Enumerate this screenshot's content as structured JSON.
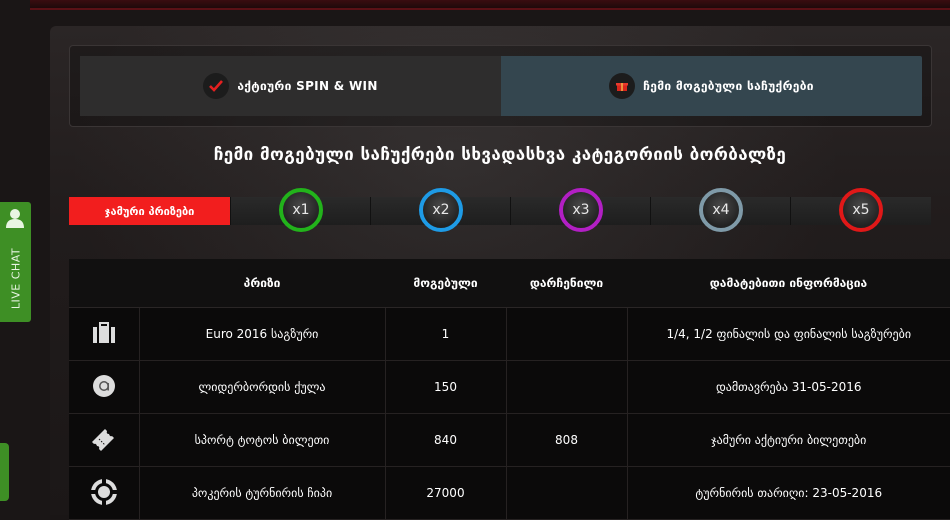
{
  "colors": {
    "accent_red": "#f21e1e",
    "live_chat_green": "#3e8f25",
    "x1": "#22b31b",
    "x2": "#1e9be6",
    "x3": "#b21fc4",
    "x4": "#7f9aa8",
    "x5": "#e01818"
  },
  "tabs": {
    "active_spin_win": "აქტიური SPIN & WIN",
    "my_gifts": "ჩემი მოგებული საჩუქრები"
  },
  "headline": "ჩემი მოგებული საჩუქრები სხვადასხვა კატეგორიის ბორბალზე",
  "filters": {
    "all": "ჯამური პრიზები",
    "multipliers": [
      "x1",
      "x2",
      "x3",
      "x4",
      "x5"
    ]
  },
  "table": {
    "headers": [
      "პრიზი",
      "მოგებული",
      "დარჩენილი",
      "დამატებითი ინფორმაცია"
    ],
    "rows": [
      {
        "icon": "briefcase-icon",
        "prize": "Euro 2016 საგზური",
        "won": "1",
        "remaining": "",
        "info": "1/4, 1/2 ფინალის და ფინალის საგზურები"
      },
      {
        "icon": "leaderboard-points-icon",
        "prize": "ლიდერბორდის ქულა",
        "won": "150",
        "remaining": "",
        "info": "დამთავრება 31-05-2016"
      },
      {
        "icon": "ticket-icon",
        "prize": "სპორტ ტოტოს ბილეთი",
        "won": "840",
        "remaining": "808",
        "info": "ჯამური აქტიური ბილეთები"
      },
      {
        "icon": "poker-chip-icon",
        "prize": "პოკერის ტურნირის ჩიპი",
        "won": "27000",
        "remaining": "",
        "info": "ტურნირის თარიღი: 23-05-2016"
      }
    ]
  },
  "live_chat": {
    "label": "LIVE CHAT",
    "icon": "user-icon"
  }
}
